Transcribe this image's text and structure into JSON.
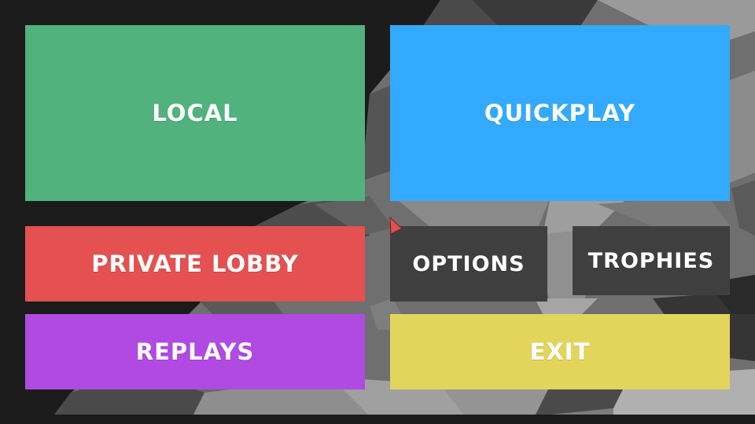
{
  "menu": {
    "local": {
      "label": "LOCAL",
      "color": "#51b27d"
    },
    "quickplay": {
      "label": "QUICKPLAY",
      "color": "#33aaff"
    },
    "private_lobby": {
      "label": "PRIVATE LOBBY",
      "color": "#e55050"
    },
    "options": {
      "label": "OPTIONS",
      "color": "#3f3f3f"
    },
    "trophies": {
      "label": "TROPHIES",
      "color": "#3f3f3f"
    },
    "replays": {
      "label": "REPLAYS",
      "color": "#b04ae3"
    },
    "exit": {
      "label": "EXIT",
      "color": "#e3d45c"
    }
  },
  "colors": {
    "background": "#1b1b1b",
    "cursor": "#d9534f"
  },
  "icons": {
    "cursor": "pointer-cursor-icon"
  }
}
